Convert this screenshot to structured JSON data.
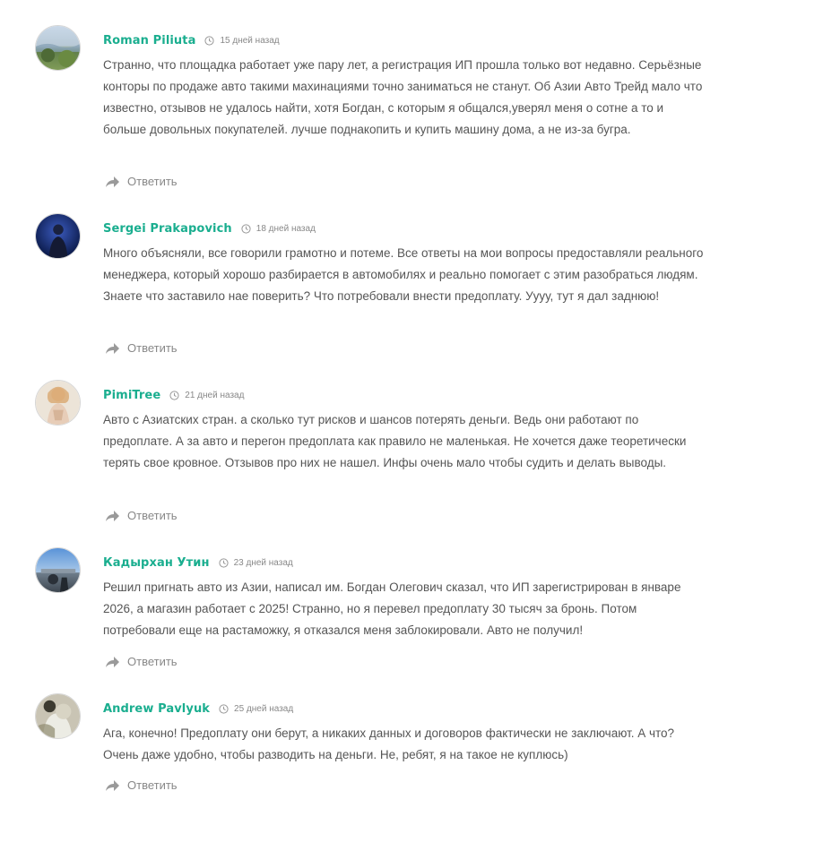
{
  "reply_label": "Ответить",
  "comments": [
    {
      "author": "Roman Piliuta",
      "time": "15 дней назад",
      "text": "Странно, что площадка работает уже пару лет, а регистрация ИП прошла только вот недавно. Серьёзные конторы по продаже авто такими махинациями точно заниматься не станут. Об Азии Авто Трейд мало что известно, отзывов не удалось найти, хотя Богдан, с которым я общался,уверял меня о сотне а то и больше довольных покупателей. лучше поднакопить и купить машину дома, а не из-за бугра."
    },
    {
      "author": "Sergei Prakapovich",
      "time": "18 дней назад",
      "text": "Много объясняли, все говорили грамотно и потеме. Все ответы на мои вопросы предоставляли реального менеджера, который хорошо разбирается в автомобилях и реально помогает с этим разобраться людям. Знаете что заставило нае поверить? Что потребовали внести предоплату. Уууу, тут я дал заднюю!"
    },
    {
      "author": "PimiTree",
      "time": "21 дней назад",
      "text": "Авто с Азиатских стран. а сколько тут рисков и шансов потерять деньги. Ведь они работают по предоплате. А за авто и перегон предоплата как правило не маленькая. Не хочется даже теоретически терять свое кровное. Отзывов про них не нашел. Инфы очень мало чтобы судить и делать выводы."
    },
    {
      "author": "Кадырхан Утин",
      "time": "23 дней назад",
      "text": "Решил пригнать авто из Азии, написал им. Богдан Олегович сказал, что ИП зарегистрирован в январе 2026, а магазин работает с 2025! Странно, но я перевел предоплату 30 тысяч за бронь. Потом потребовали еще на растаможку, я отказался меня заблокировали. Авто не получил!"
    },
    {
      "author": "Andrew Pavlyuk",
      "time": "25 дней назад",
      "text": "Ага, конечно! Предоплату они берут, а никаких данных и договоров фактически не заключают. А что? Очень даже удобно, чтобы разводить на деньги. Не, ребят, я на такое не куплюсь)"
    }
  ]
}
